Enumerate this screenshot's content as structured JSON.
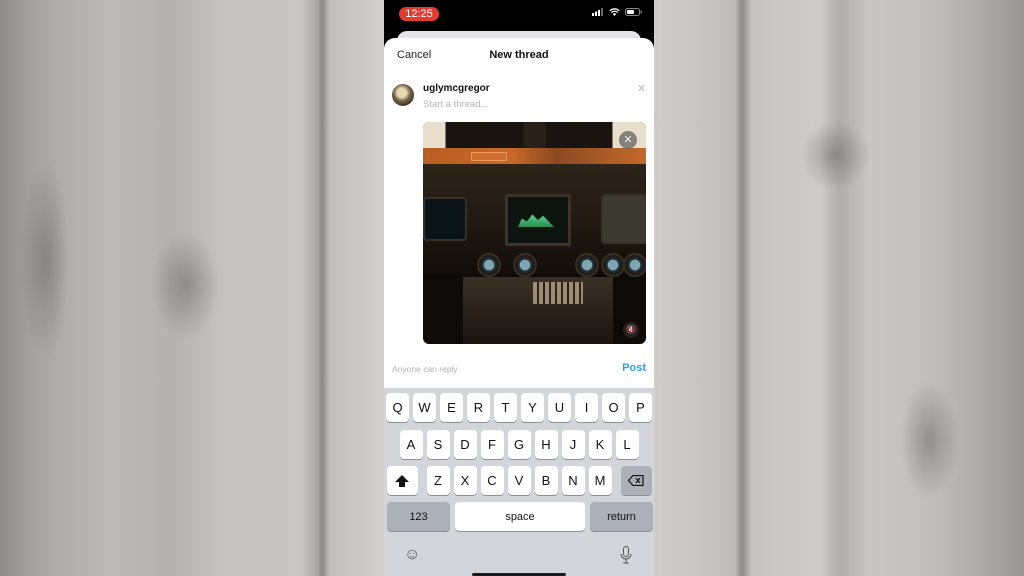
{
  "status_bar": {
    "time": "12:25",
    "icons": [
      "cellular-signal-icon",
      "wifi-icon",
      "battery-icon"
    ]
  },
  "composer": {
    "cancel_label": "Cancel",
    "title": "New thread",
    "username": "uglymcgregor",
    "text_placeholder": "Start a thread...",
    "remove_icon": "close-icon",
    "media": {
      "description": "Video thumbnail of a weathered aircraft cockpit instrument panel",
      "remove_icon": "close-icon",
      "mute_icon": "muted-speaker-icon"
    },
    "reply_permission": "Anyone can reply",
    "post_label": "Post",
    "accent_color": "#2fa3e8"
  },
  "keyboard": {
    "row1": [
      "Q",
      "W",
      "E",
      "R",
      "T",
      "Y",
      "U",
      "I",
      "O",
      "P"
    ],
    "row2": [
      "A",
      "S",
      "D",
      "F",
      "G",
      "H",
      "J",
      "K",
      "L"
    ],
    "row3": [
      "Z",
      "X",
      "C",
      "V",
      "B",
      "N",
      "M"
    ],
    "shift_icon": "shift-arrow-icon",
    "delete_icon": "backspace-icon",
    "numbers_label": "123",
    "space_label": "space",
    "return_label": "return",
    "emoji_icon": "emoji-icon",
    "dictation_icon": "microphone-icon"
  }
}
